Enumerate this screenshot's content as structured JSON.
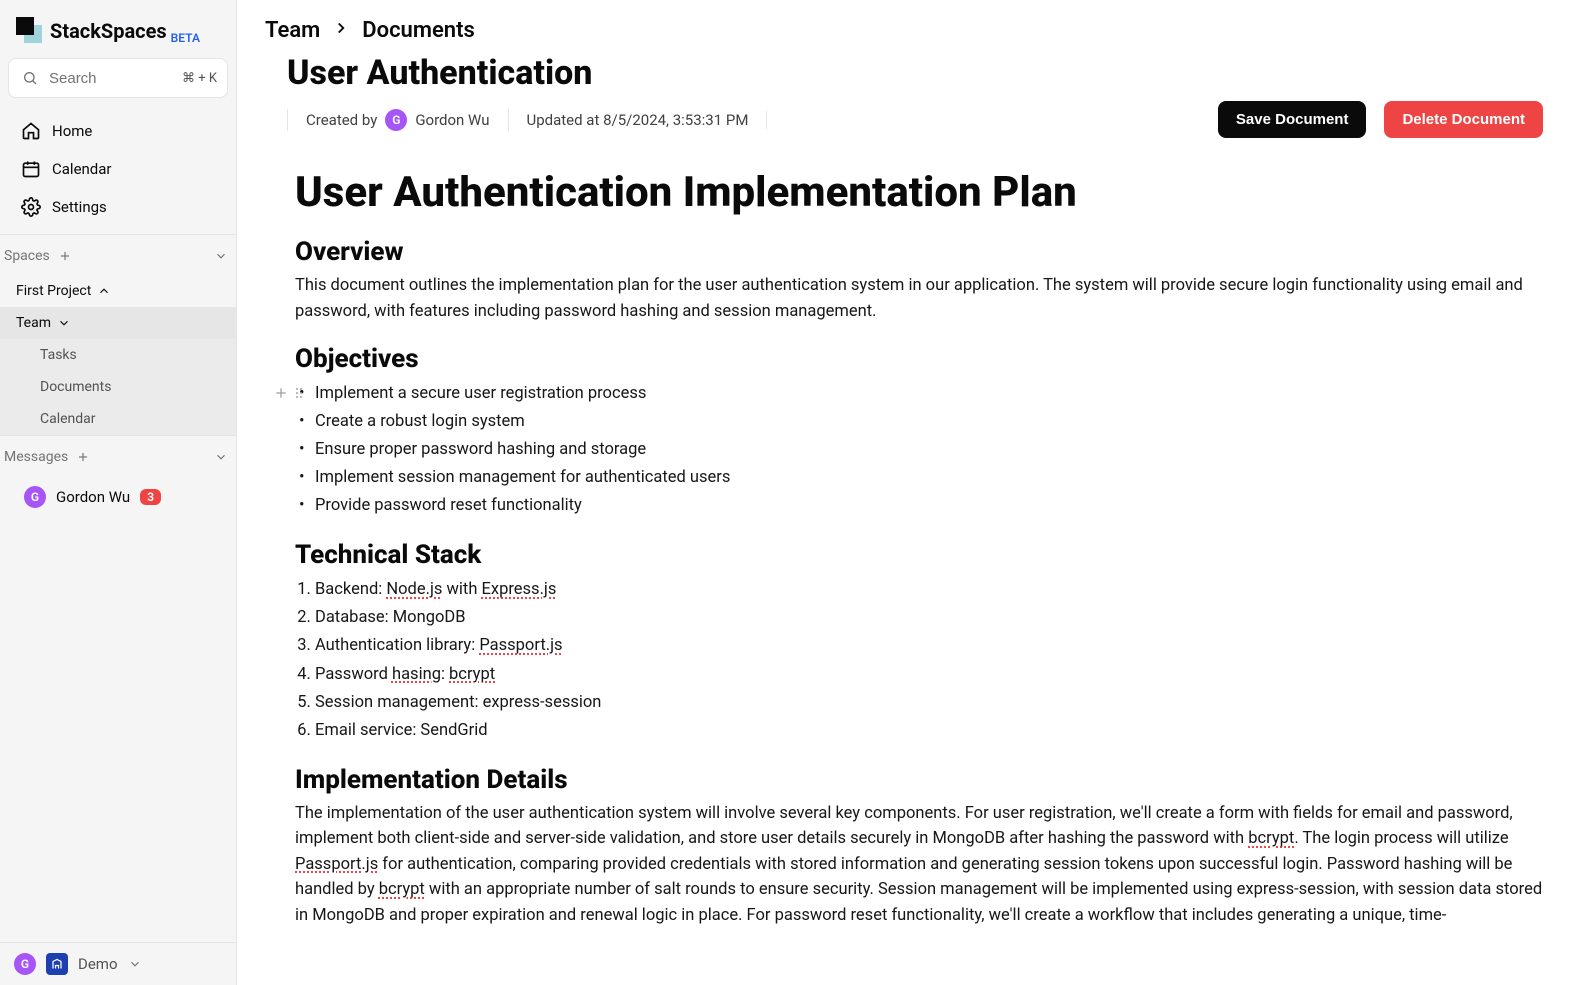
{
  "app": {
    "name": "StackSpaces",
    "beta_label": "BETA"
  },
  "search": {
    "placeholder": "Search",
    "shortcut": "⌘ + K"
  },
  "nav": {
    "home": "Home",
    "calendar": "Calendar",
    "settings": "Settings"
  },
  "sections": {
    "spaces_label": "Spaces",
    "messages_label": "Messages"
  },
  "spaces": {
    "first_project": "First Project",
    "team": "Team",
    "children": {
      "tasks": "Tasks",
      "documents": "Documents",
      "calendar": "Calendar"
    }
  },
  "messages": {
    "dm_name": "Gordon Wu",
    "dm_badge": "3",
    "dm_initial": "G"
  },
  "footer": {
    "avatar_initial": "G",
    "org_label": "Demo"
  },
  "breadcrumb": {
    "a": "Team",
    "b": "Documents"
  },
  "document": {
    "title": "User Authentication",
    "created_by_label": "Created by",
    "author_name": "Gordon Wu",
    "author_initial": "G",
    "updated_label": "Updated at 8/5/2024, 3:53:31 PM",
    "save_label": "Save Document",
    "delete_label": "Delete Document"
  },
  "content": {
    "h1": "User Authentication Implementation Plan",
    "overview_h": "Overview",
    "overview_p": "This document outlines the implementation plan for the user authentication system in our application. The system will provide secure login functionality using email and password, with features including password hashing and session management.",
    "objectives_h": "Objectives",
    "objectives": [
      "Implement a secure user registration process",
      "Create a robust login system",
      "Ensure proper password hashing and storage",
      "Implement session management for authenticated users",
      "Provide password reset functionality"
    ],
    "tech_h": "Technical Stack",
    "tech": {
      "t1_a": "Backend: ",
      "t1_b": "Node.js",
      "t1_c": " with ",
      "t1_d": "Express.js",
      "t2": "Database: MongoDB",
      "t3_a": "Authentication library: ",
      "t3_b": "Passport.js",
      "t4_a": "Password ",
      "t4_b": "hasing",
      "t4_c": ": ",
      "t4_d": "bcrypt",
      "t5": "Session management: express-session",
      "t6": "Email service: SendGrid"
    },
    "impl_h": "Implementation Details",
    "impl": {
      "p1": "The implementation of the user authentication system will involve several key components. For user registration, we'll create a form with fields for email and password, implement both client-side and server-side validation, and store user details securely in MongoDB after hashing the password with ",
      "p1_s1": "bcrypt",
      "p2": ". The login process will utilize ",
      "p2_s1": "Passport.js",
      "p3": " for authentication, comparing provided credentials with stored information and generating session tokens upon successful login. Password hashing will be handled by ",
      "p3_s1": "bcrypt",
      "p4": " with an appropriate number of salt rounds to ensure security. Session management will be implemented using express-session, with session data stored in MongoDB and proper expiration and renewal logic in place. For password reset functionality, we'll create a workflow that includes generating a unique, time-"
    }
  }
}
